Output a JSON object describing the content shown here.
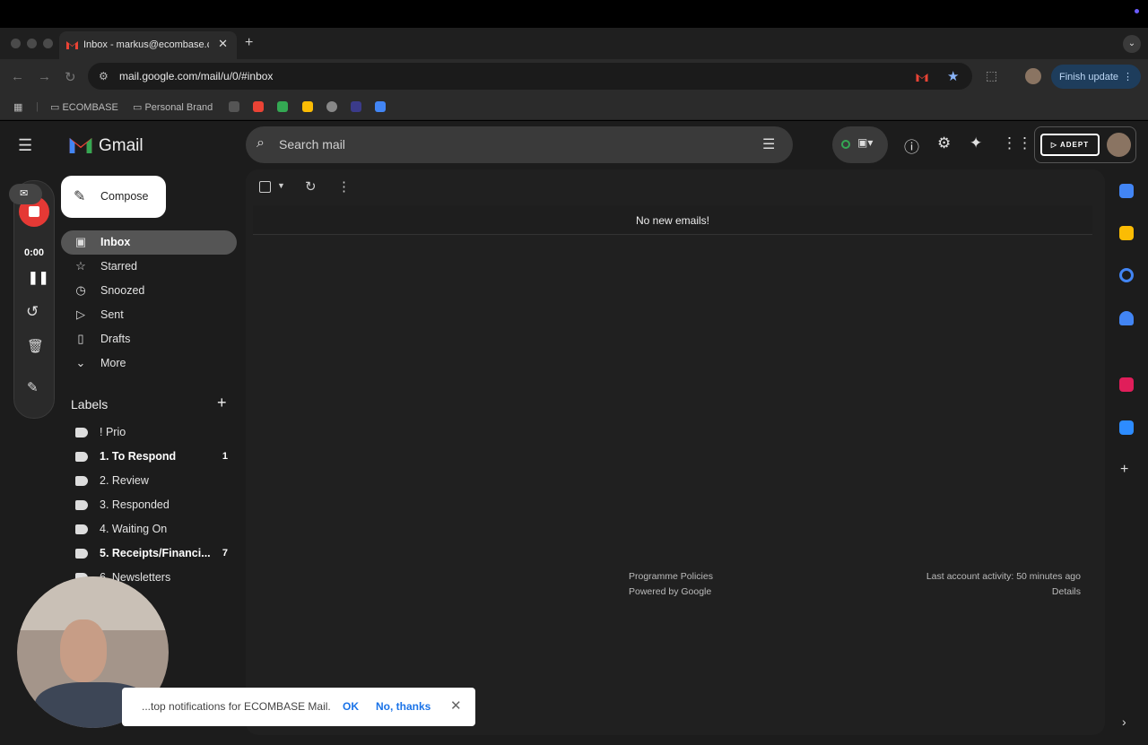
{
  "browser": {
    "tab_title": "Inbox - markus@ecombase.c",
    "url": "mail.google.com/mail/u/0/#inbox",
    "finish_update": "Finish update",
    "bookmarks": [
      "ECOMBASE",
      "Personal Brand"
    ]
  },
  "gmail": {
    "logo": "Gmail",
    "search_placeholder": "Search mail",
    "compose": "Compose",
    "nav": [
      {
        "label": "Inbox",
        "icon": "inbox-icon",
        "active": true
      },
      {
        "label": "Starred",
        "icon": "star-icon"
      },
      {
        "label": "Snoozed",
        "icon": "clock-icon"
      },
      {
        "label": "Sent",
        "icon": "send-icon"
      },
      {
        "label": "Drafts",
        "icon": "file-icon"
      },
      {
        "label": "More",
        "icon": "chevron-down-icon"
      }
    ],
    "labels_title": "Labels",
    "labels": [
      {
        "name": "! Prio",
        "count": "",
        "bold": false
      },
      {
        "name": "1. To Respond",
        "count": "1",
        "bold": true
      },
      {
        "name": "2. Review",
        "count": "",
        "bold": false
      },
      {
        "name": "3. Responded",
        "count": "",
        "bold": false
      },
      {
        "name": "4. Waiting On",
        "count": "",
        "bold": false
      },
      {
        "name": "5. Receipts/Financi...",
        "count": "7",
        "bold": true
      },
      {
        "name": "6. Newsletters",
        "count": "",
        "bold": false
      }
    ],
    "empty_message": "No new emails!",
    "footer": {
      "policies": "Programme Policies",
      "powered": "Powered by Google",
      "activity": "Last account activity: 50 minutes ago",
      "details": "Details"
    },
    "adept": "ADEPT"
  },
  "recorder": {
    "time": "0:00"
  },
  "notification": {
    "text": "...top notifications for ECOMBASE Mail.",
    "ok": "OK",
    "no_thanks": "No, thanks"
  }
}
